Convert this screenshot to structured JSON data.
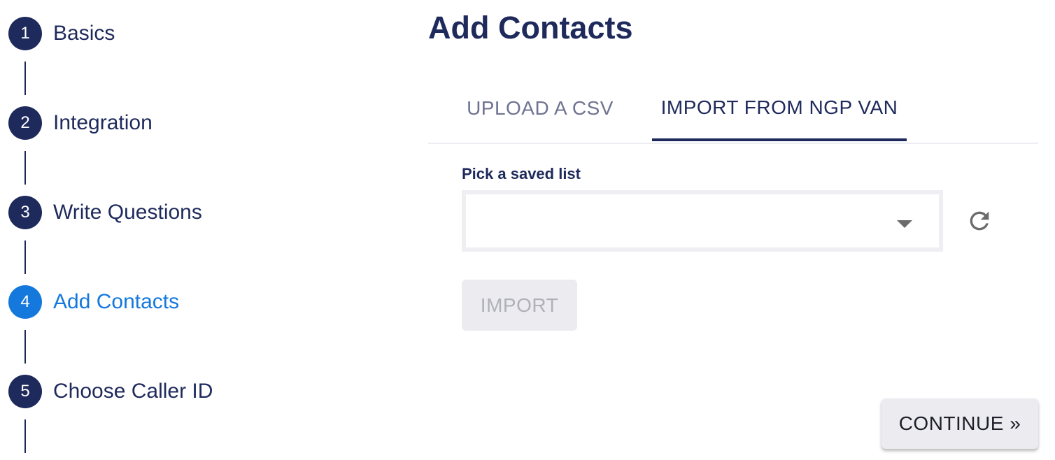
{
  "stepper": {
    "steps": [
      {
        "number": "1",
        "label": "Basics"
      },
      {
        "number": "2",
        "label": "Integration"
      },
      {
        "number": "3",
        "label": "Write Questions"
      },
      {
        "number": "4",
        "label": "Add Contacts"
      },
      {
        "number": "5",
        "label": "Choose Caller ID"
      }
    ],
    "active_step": "4"
  },
  "page": {
    "title": "Add Contacts"
  },
  "tabs": [
    {
      "label": "UPLOAD A CSV",
      "selected": false
    },
    {
      "label": "IMPORT FROM NGP VAN",
      "selected": true
    }
  ],
  "form": {
    "saved_list_label": "Pick a saved list",
    "saved_list_value": "",
    "refresh_icon": "refresh-icon",
    "import_label": "IMPORT",
    "import_enabled": false
  },
  "footer": {
    "continue_label": "CONTINUE »"
  },
  "colors": {
    "primary": "#1f2a5c",
    "active": "#1478dc",
    "disabled_bg": "#ebebf0",
    "disabled_text": "#b0b0b8"
  }
}
